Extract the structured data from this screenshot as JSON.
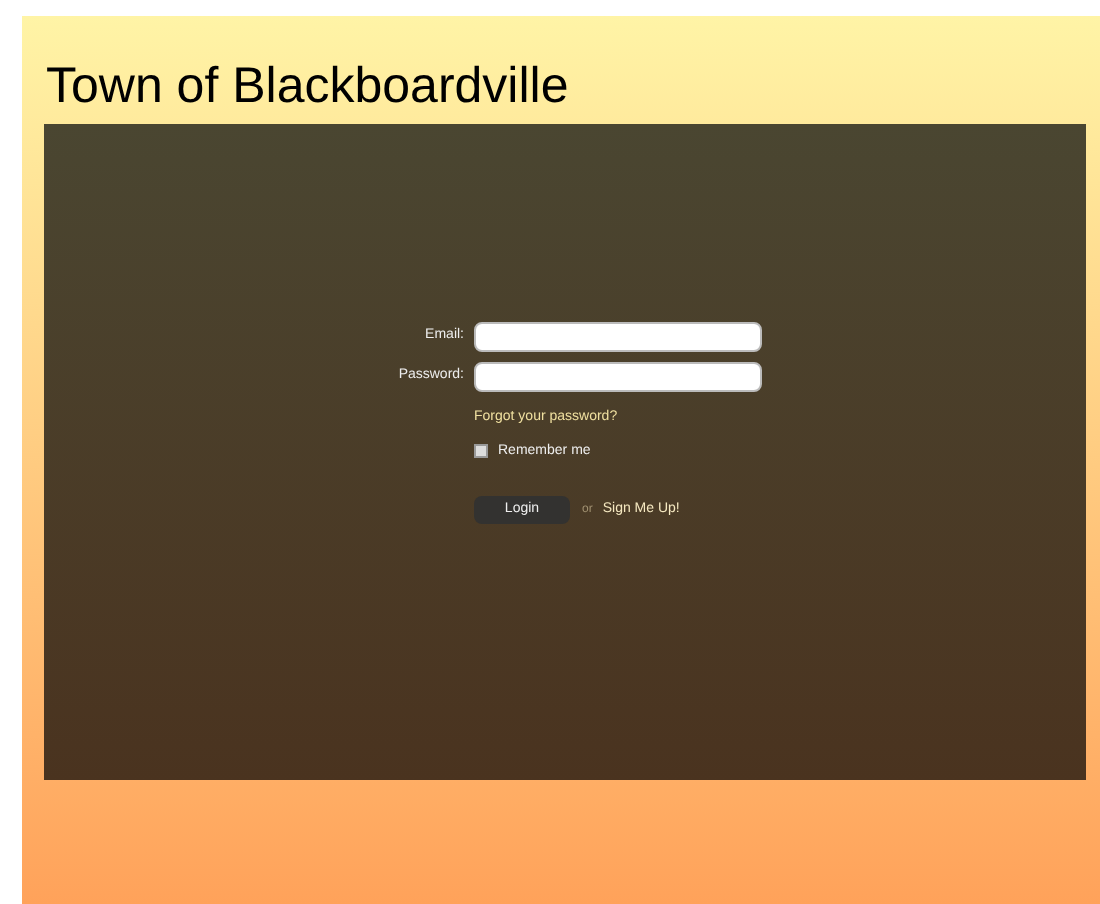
{
  "title": "Town of Blackboardville",
  "form": {
    "fields": [
      {
        "label": "Email:"
      },
      {
        "label": "Password:"
      }
    ],
    "forgot_link": "Forgot your password?",
    "remember": {
      "label": "Remember me",
      "checked": false
    },
    "login_button": "Login",
    "separator": "or",
    "signup_link": "Sign Me Up!"
  }
}
